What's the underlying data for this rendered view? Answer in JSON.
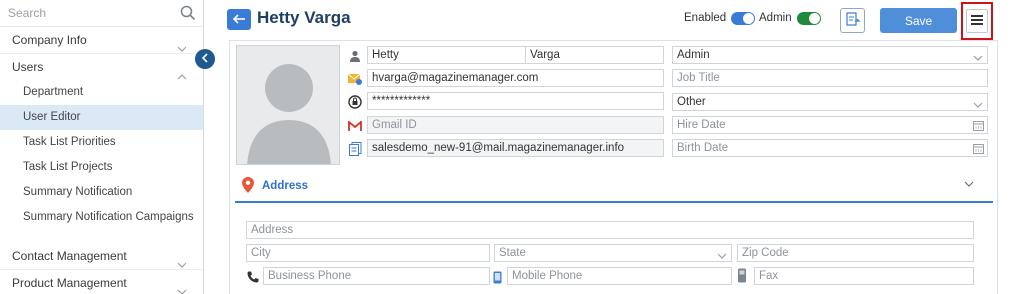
{
  "sidebar": {
    "search_placeholder": "Search",
    "items": [
      {
        "label": "Company Info"
      },
      {
        "label": "Users"
      },
      {
        "label": "Department"
      },
      {
        "label": "User Editor"
      },
      {
        "label": "Task List Priorities"
      },
      {
        "label": "Task List Projects"
      },
      {
        "label": "Summary Notification"
      },
      {
        "label": "Summary Notification Campaigns"
      },
      {
        "label": "Contact Management"
      },
      {
        "label": "Product Management"
      }
    ]
  },
  "header": {
    "title": "Hetty Varga",
    "enabled_label": "Enabled",
    "admin_label": "Admin",
    "save_label": "Save",
    "accent_color": "#3a7bd5",
    "enabled_toggle_color": "#3a7bd5",
    "admin_toggle_color": "#1f8a3b",
    "highlight_color": "#d0101d"
  },
  "form": {
    "first_name": "Hetty",
    "last_name": "Varga",
    "role": "Admin",
    "email": "hvarga@magazinemanager.com",
    "job_title_placeholder": "Job Title",
    "password": "*************",
    "gender": "Other",
    "gmail_placeholder": "Gmail ID",
    "hire_date_placeholder": "Hire Date",
    "sales_email": "salesdemo_new-91@mail.magazinemanager.info",
    "birth_date_placeholder": "Birth Date"
  },
  "address": {
    "section_label": "Address",
    "address_placeholder": "Address",
    "city_placeholder": "City",
    "state_placeholder": "State",
    "zip_placeholder": "Zip Code",
    "business_phone_placeholder": "Business Phone",
    "mobile_phone_placeholder": "Mobile Phone",
    "fax_placeholder": "Fax"
  }
}
